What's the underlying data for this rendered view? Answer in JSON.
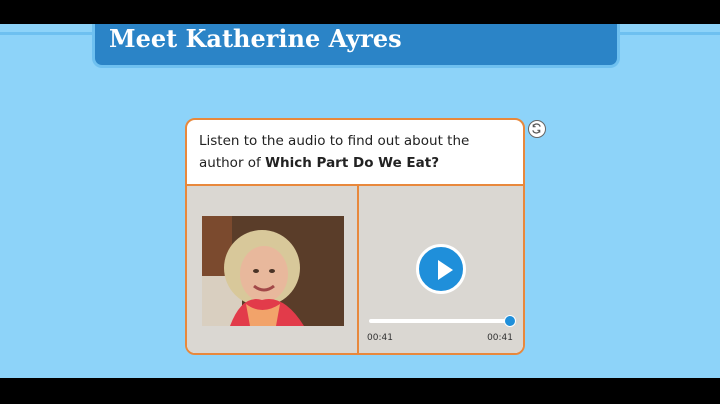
{
  "header": {
    "title": "Meet Katherine Ayres"
  },
  "card": {
    "prompt_lead": "Listen to the audio to find out about the author of ",
    "prompt_book": "Which Part Do We Eat?",
    "player": {
      "current_time": "00:41",
      "duration": "00:41",
      "progress_fraction": 1.0
    }
  },
  "icons": {
    "refresh": "refresh-icon",
    "play": "play-icon"
  },
  "colors": {
    "background": "#8dd3f9",
    "header": "#2b84c7",
    "accent_border": "#e8883c",
    "play_button": "#1f8fda"
  }
}
